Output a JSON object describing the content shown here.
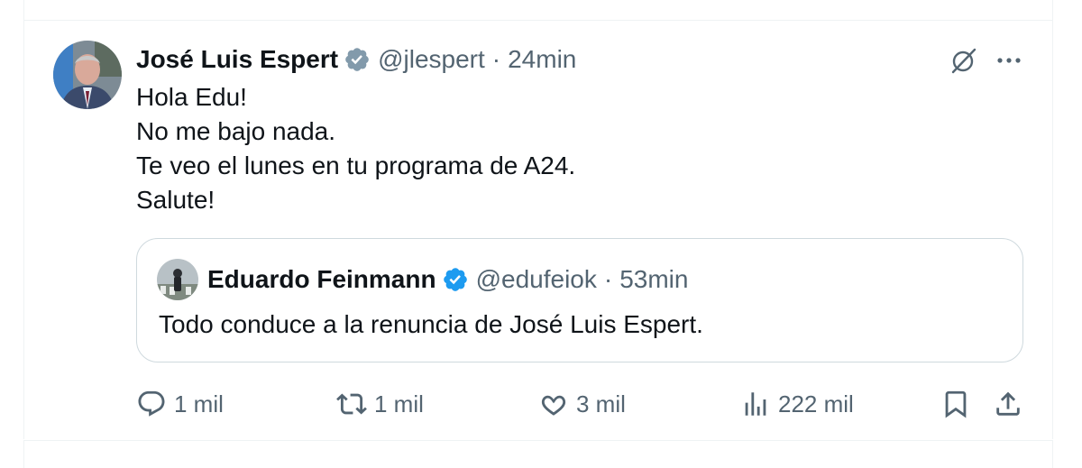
{
  "tweet": {
    "author_name": "José Luis Espert",
    "author_handle": "@jlespert",
    "separator": "·",
    "time": "24min",
    "text_lines": [
      "Hola Edu!",
      "No me bajo nada.",
      "Te veo el lunes en tu programa de A24.",
      "Salute!"
    ]
  },
  "quote": {
    "author_name": "Eduardo Feinmann",
    "author_handle": "@edufeiok",
    "separator": "·",
    "time": "53min",
    "text": "Todo conduce a la renuncia de José Luis Espert."
  },
  "actions": {
    "reply_count": "1 mil",
    "repost_count": "1 mil",
    "like_count": "3 mil",
    "views_count": "222 mil"
  },
  "icons": {
    "verified": "verified-badge-icon",
    "grok": "grok-icon",
    "more": "more-icon",
    "reply": "reply-icon",
    "repost": "repost-icon",
    "like": "like-icon",
    "views": "views-icon",
    "bookmark": "bookmark-icon",
    "share": "share-icon"
  },
  "colors": {
    "verified_blue": "#1d9bf0",
    "text_primary": "#0f1419",
    "text_secondary": "#536471",
    "border": "#cfd9de"
  }
}
